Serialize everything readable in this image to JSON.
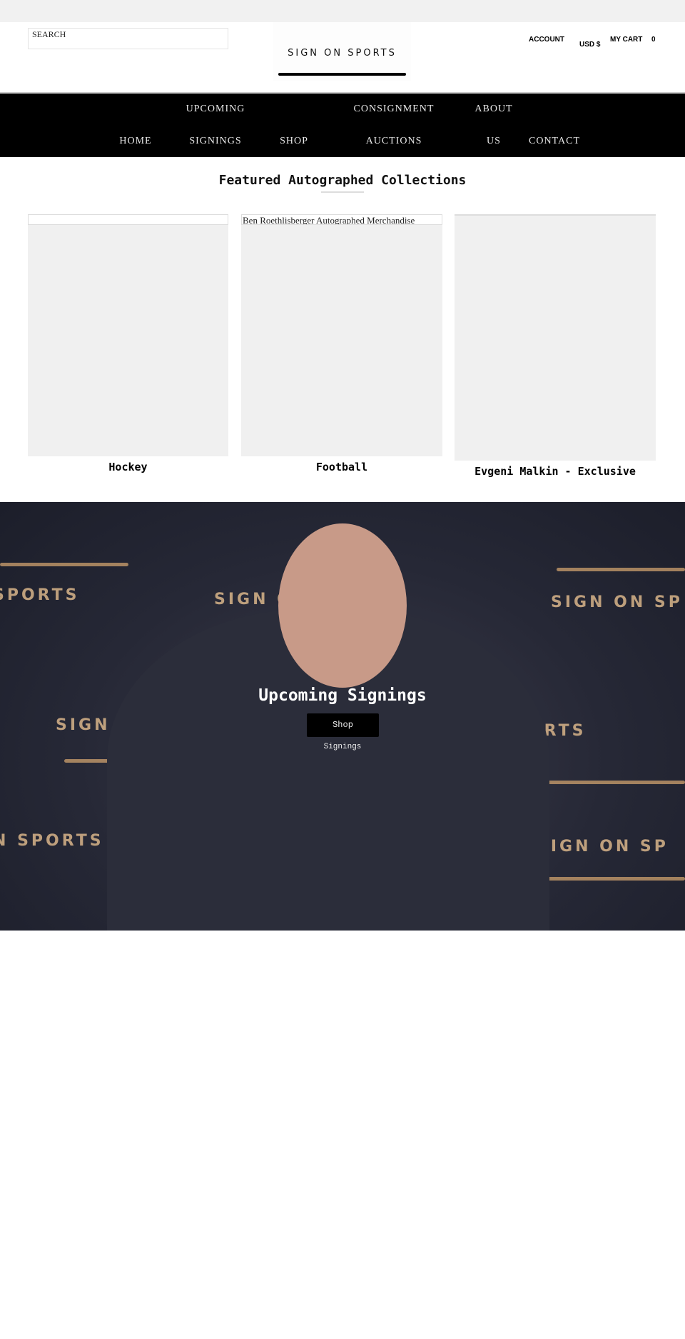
{
  "header": {
    "search_placeholder": "SEARCH",
    "logo": "SIGN ON SPORTS",
    "account": "ACCOUNT",
    "currency": "USD $",
    "cart": "MY CART",
    "cart_count": "0"
  },
  "nav": {
    "upcoming": "UPCOMING",
    "consignment": "CONSIGNMENT",
    "about": "ABOUT",
    "home": "HOME",
    "signings": "SIGNINGS",
    "shop": "SHOP",
    "auctions": "AUCTIONS",
    "us": "US",
    "contact": "CONTACT"
  },
  "featured": {
    "title": "Featured Autographed Collections",
    "cards": [
      {
        "label": "Hockey",
        "caption": ""
      },
      {
        "label": "Football",
        "caption": "Ben Roethlisberger Autographed Merchandise"
      },
      {
        "label": "Evgeni Malkin - Exclusive",
        "caption": ""
      }
    ]
  },
  "hero": {
    "title": "Upcoming Signings",
    "button": "Shop",
    "subtitle": "Signings",
    "watermark": "SIGN ON SPORTS"
  }
}
